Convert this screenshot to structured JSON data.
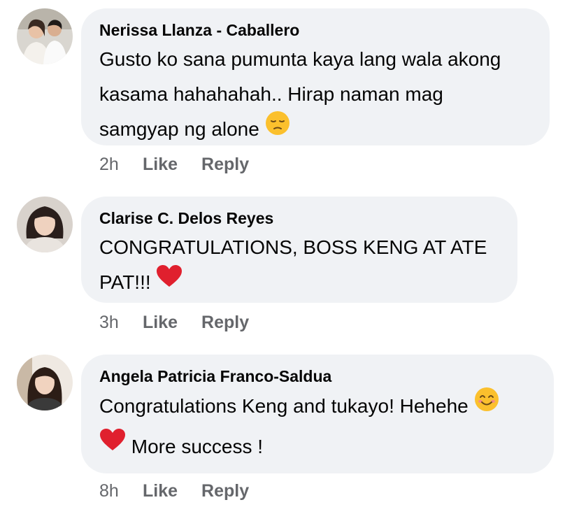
{
  "comments": [
    {
      "author": "Nerissa Llanza - Caballero",
      "lines": [
        "Gusto ko sana pumunta kaya lang wala akong",
        "kasama hahahahah.. Hirap naman mag",
        "samgyap ng alone"
      ],
      "trailing_emoji": "pensive-face-emoji",
      "time": "2h",
      "like": "Like",
      "reply": "Reply"
    },
    {
      "author": "Clarise C. Delos Reyes",
      "lines": [
        "CONGRATULATIONS, BOSS KENG AT ATE",
        "PAT!!!"
      ],
      "trailing_emoji": "red-heart-emoji",
      "time": "3h",
      "like": "Like",
      "reply": "Reply"
    },
    {
      "author": "Angela Patricia Franco-Saldua",
      "lines": [
        "Congratulations Keng and tukayo! Hehehe",
        "More success !"
      ],
      "emojis": [
        "smiling-face-emoji",
        "red-heart-emoji"
      ],
      "time": "8h",
      "like": "Like",
      "reply": "Reply"
    }
  ],
  "colors": {
    "bubble": "#f0f2f5",
    "text": "#050505",
    "meta": "#65676b",
    "heart": "#e0202e",
    "emoji_yellow": "#fbc02d"
  }
}
